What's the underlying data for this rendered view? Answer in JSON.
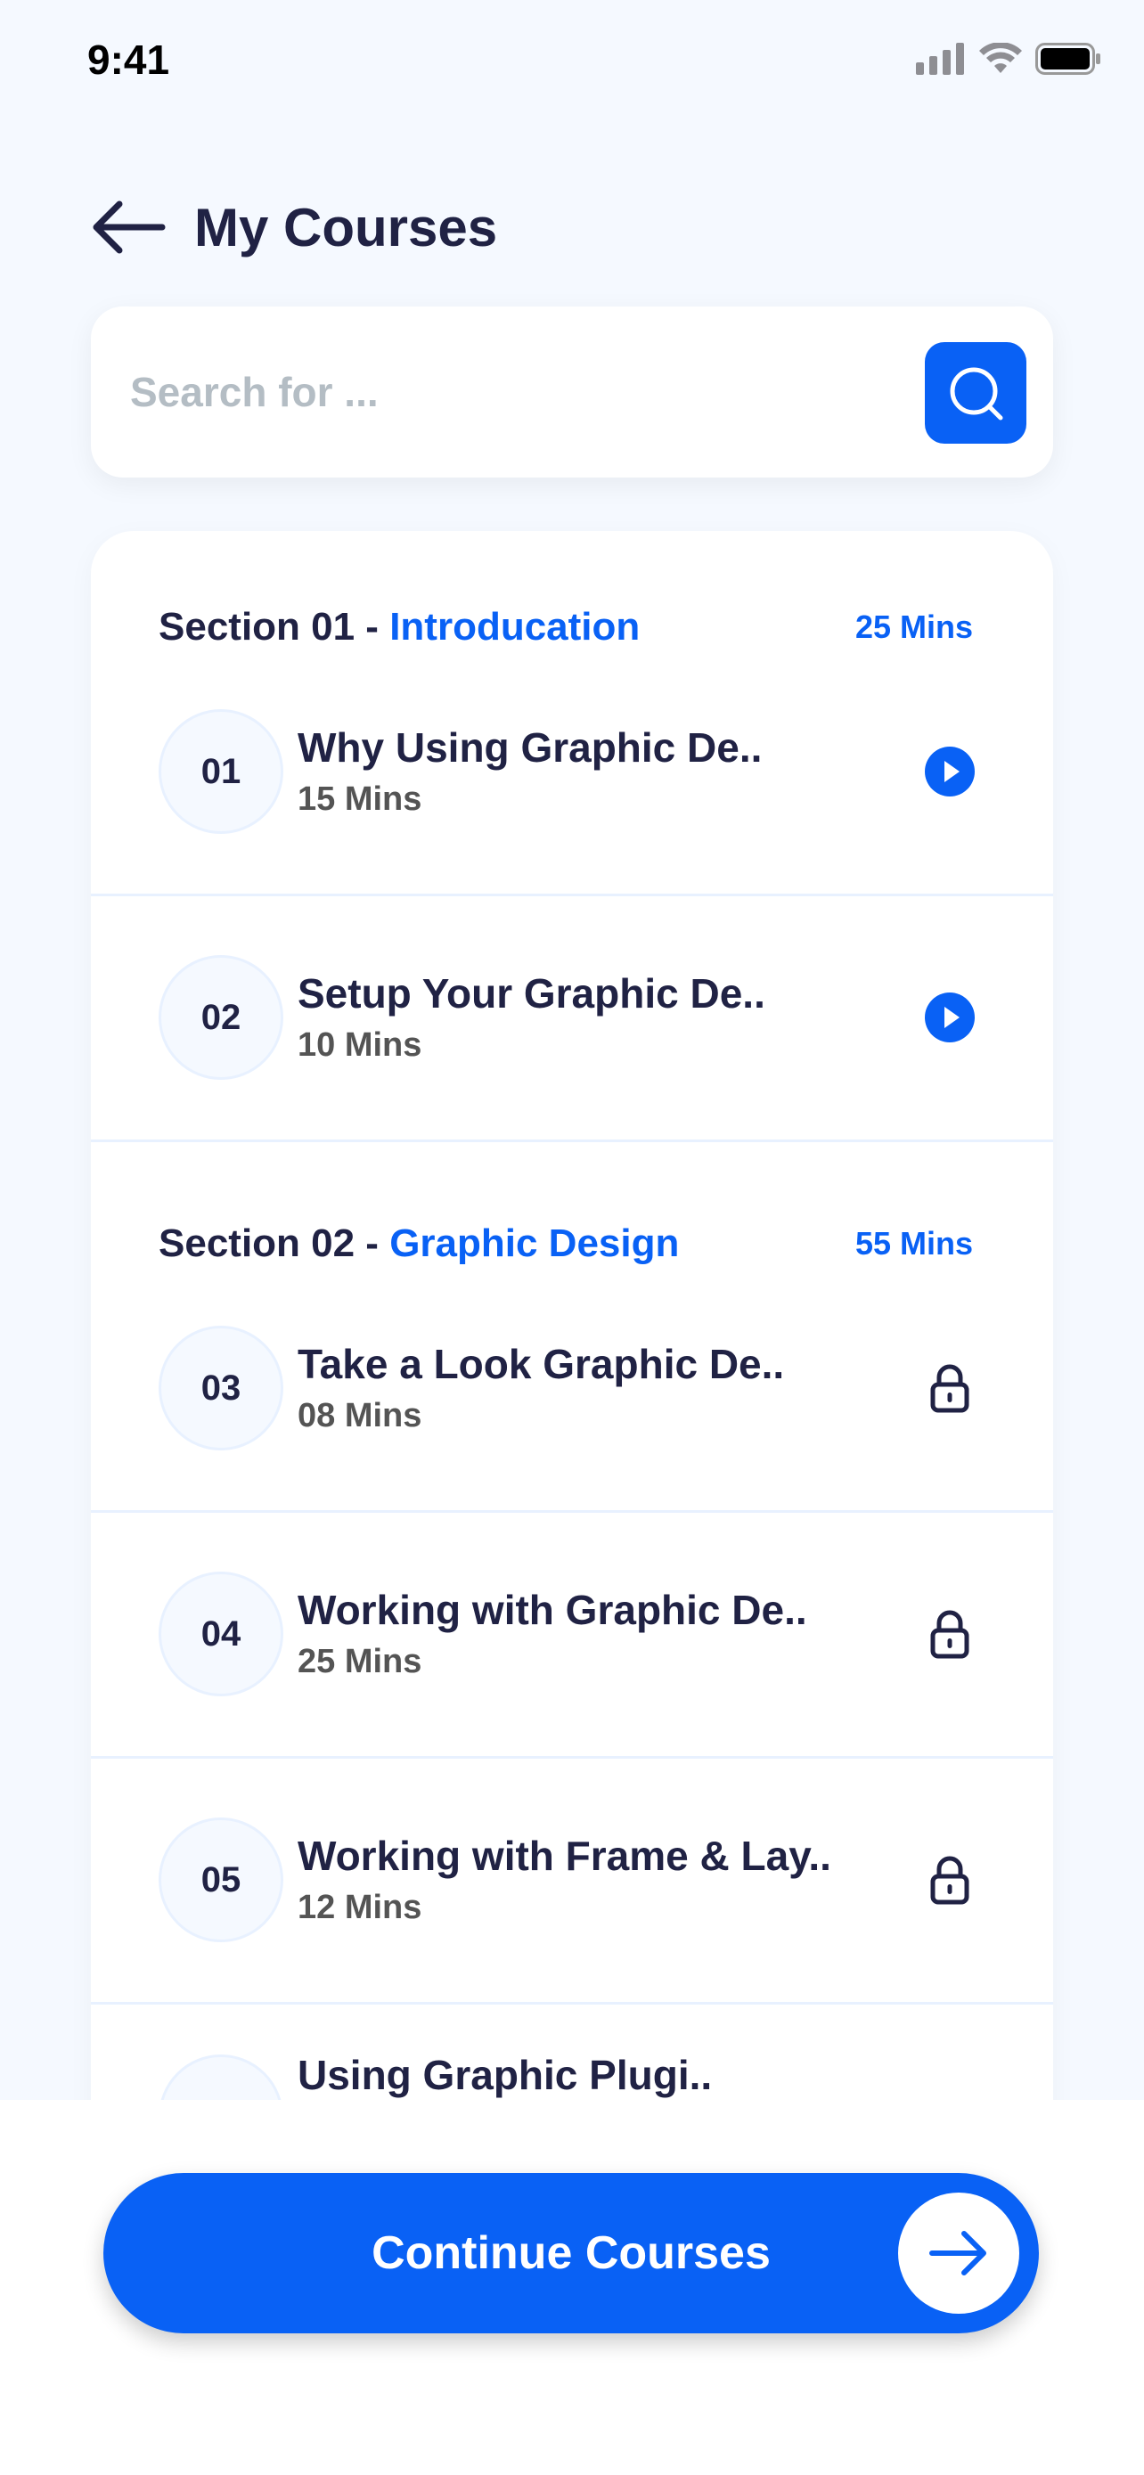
{
  "status_bar": {
    "time": "9:41"
  },
  "header": {
    "title": "My Courses"
  },
  "search": {
    "placeholder": "Search for ..."
  },
  "sections": [
    {
      "title": "Section 01 - ",
      "name": "Introducation",
      "duration": "25 Mins"
    },
    {
      "title": "Section 02 - ",
      "name": "Graphic Design",
      "duration": "55 Mins"
    }
  ],
  "lessons": [
    {
      "number": "01",
      "title": "Why Using Graphic De..",
      "duration": "15 Mins",
      "action": "play-icon"
    },
    {
      "number": "02",
      "title": "Setup Your Graphic De..",
      "duration": "10 Mins",
      "action": "play-icon"
    },
    {
      "number": "03",
      "title": "Take a Look Graphic De..",
      "duration": "08 Mins",
      "action": "lock-icon"
    },
    {
      "number": "04",
      "title": "Working with Graphic De..",
      "duration": "25 Mins",
      "action": "lock-icon"
    },
    {
      "number": "05",
      "title": "Working with Frame & Lay..",
      "duration": "12 Mins",
      "action": "lock-icon"
    },
    {
      "number": "",
      "title": "Using Graphic Plugi..",
      "duration": "",
      "action": ""
    }
  ],
  "bottom": {
    "continue_label": "Continue Courses"
  },
  "colors": {
    "primary": "#0961F5",
    "background": "#F5F9FF",
    "text": "#202244",
    "muted": "#545454"
  }
}
